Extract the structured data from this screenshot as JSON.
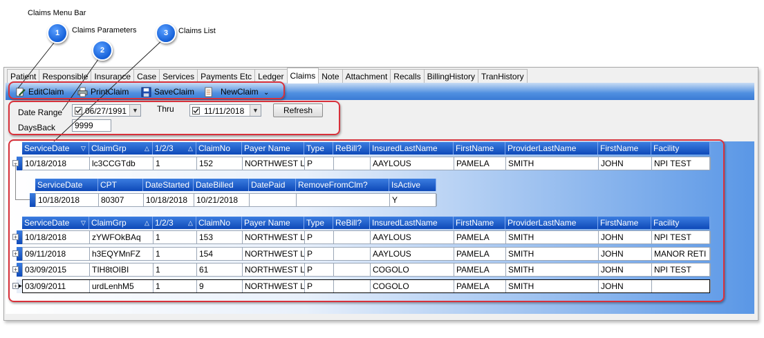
{
  "callouts": {
    "menu_bar": "Claims Menu Bar",
    "parameters": "Claims Parameters",
    "list": "Claims List",
    "badges": [
      "1",
      "2",
      "3"
    ]
  },
  "tabs": [
    "Patient",
    "Responsible",
    "Insurance",
    "Case",
    "Services",
    "Payments Etc",
    "Ledger",
    "Claims",
    "Note",
    "Attachment",
    "Recalls",
    "BillingHistory",
    "TranHistory"
  ],
  "active_tab": "Claims",
  "toolbar": {
    "edit": "EditClaim",
    "print": "PrintClaim",
    "save": "SaveClaim",
    "new": "NewClaim",
    "overflow": "⌄"
  },
  "params": {
    "date_range_label": "Date Range",
    "from_date": "06/27/1991",
    "thru_label": "Thru",
    "thru_date": "11/11/2018",
    "refresh": "Refresh",
    "daysback_label": "DaysBack",
    "daysback_value": "9999"
  },
  "grid": {
    "columns": [
      "ServiceDate",
      "ClaimGrp",
      "1/2/3",
      "ClaimNo",
      "Payer Name",
      "Type",
      "ReBill?",
      "InsuredLastName",
      "FirstName",
      "ProviderLastName",
      "FirstName",
      "Facility"
    ],
    "sort_indicators": {
      "ServiceDate": "▽",
      "ClaimGrp": "△",
      "1/2/3": "△"
    },
    "expanded_row": [
      "10/18/2018",
      "lc3CCGTdb",
      "1",
      "152",
      "NORTHWEST L",
      "P",
      "",
      "AAYLOUS",
      "PAMELA",
      "SMITH",
      "JOHN",
      "NPI TEST"
    ],
    "child": {
      "columns": [
        "ServiceDate",
        "CPT",
        "DateStarted",
        "DateBilled",
        "DatePaid",
        "RemoveFromClm?",
        "IsActive"
      ],
      "row": [
        "10/18/2018",
        "80307",
        "10/18/2018",
        "10/21/2018",
        "",
        "",
        "Y"
      ]
    },
    "rows": [
      [
        "10/18/2018",
        "zYWFOkBAq",
        "1",
        "153",
        "NORTHWEST L",
        "P",
        "",
        "AAYLOUS",
        "PAMELA",
        "SMITH",
        "JOHN",
        "NPI TEST"
      ],
      [
        "09/11/2018",
        "h3EQYMnFZ",
        "1",
        "154",
        "NORTHWEST L",
        "P",
        "",
        "AAYLOUS",
        "PAMELA",
        "SMITH",
        "JOHN",
        "MANOR RETI"
      ],
      [
        "03/09/2015",
        "TIH8tOIBI",
        "1",
        "61",
        "NORTHWEST L",
        "P",
        "",
        "COGOLO",
        "PAMELA",
        "SMITH",
        "JOHN",
        "NPI TEST"
      ],
      [
        "03/09/2011",
        "urdLenhM5",
        "1",
        "9",
        "NORTHWEST L",
        "P",
        "",
        "COGOLO",
        "PAMELA",
        "SMITH",
        "JOHN",
        ""
      ]
    ],
    "selected_row": 3
  },
  "colors": {
    "accent": "#1560d8",
    "highlight": "#d8303a",
    "header": "#0e49b8"
  }
}
